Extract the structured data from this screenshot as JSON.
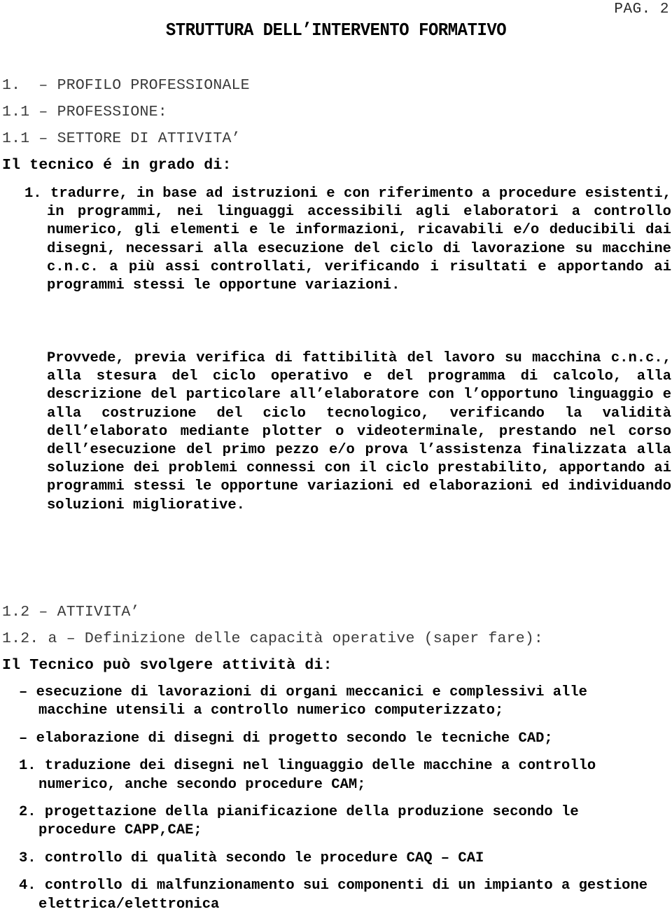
{
  "header": {
    "page_label": "PAG. 2",
    "title": "STRUTTURA DELL’INTERVENTO FORMATIVO"
  },
  "outline": {
    "h1": "1.  – PROFILO PROFESSIONALE",
    "h1_1a": "1.1 – PROFESSIONE:",
    "h1_1b": "1.1 – SETTORE DI ATTIVITA’",
    "lead_in": "Il tecnico é in grado di:"
  },
  "body": {
    "item1": "1. tradurre, in base ad istruzioni e con riferimento a procedure esistenti, in programmi, nei linguaggi accessibili agli elaboratori a controllo numerico, gli elementi e le informazioni, ricavabili e/o deducibili dai disegni, necessari alla esecuzione del ciclo di lavorazione su macchine c.n.c. a più assi controllati, verificando i risultati e apportando ai programmi stessi le opportune variazioni.",
    "para2": "Provvede, previa verifica di fattibilità del lavoro su macchina c.n.c., alla stesura del ciclo operativo e del programma di calcolo, alla descrizione del particolare all’elaboratore con l’opportuno linguaggio e alla costruzione del ciclo tecnologico, verificando la validità dell’elaborato mediante plotter o videoterminale, prestando nel corso dell’esecuzione del primo pezzo e/o prova l’assistenza finalizzata alla soluzione dei problemi connessi con il ciclo prestabilito, apportando ai programmi stessi le opportune variazioni ed elaborazioni ed individuando soluzioni migliorative."
  },
  "section2": {
    "h1_2": "1.2 – ATTIVITA’",
    "h1_2a": "1.2. a – Definizione delle capacità operative (saper fare):",
    "lead_in": "Il Tecnico può svolgere attività di:",
    "items": [
      {
        "marker": "– ",
        "text": "esecuzione di lavorazioni di organi meccanici e complessivi alle macchine utensili a controllo numerico computerizzato;"
      },
      {
        "marker": "– ",
        "text": "elaborazione di disegni di progetto secondo le tecniche CAD;"
      },
      {
        "marker": "1. ",
        "text": "traduzione dei disegni nel linguaggio delle macchine a controllo numerico, anche secondo procedure CAM;"
      },
      {
        "marker": "2. ",
        "text": "progettazione della pianificazione della produzione secondo le procedure CAPP,CAE;"
      },
      {
        "marker": "3. ",
        "text": "controllo di qualità secondo le procedure CAQ – CAI"
      },
      {
        "marker": "4. ",
        "text": "controllo di malfunzionamento sui componenti di un impianto a gestione elettrica/elettronica"
      }
    ]
  }
}
